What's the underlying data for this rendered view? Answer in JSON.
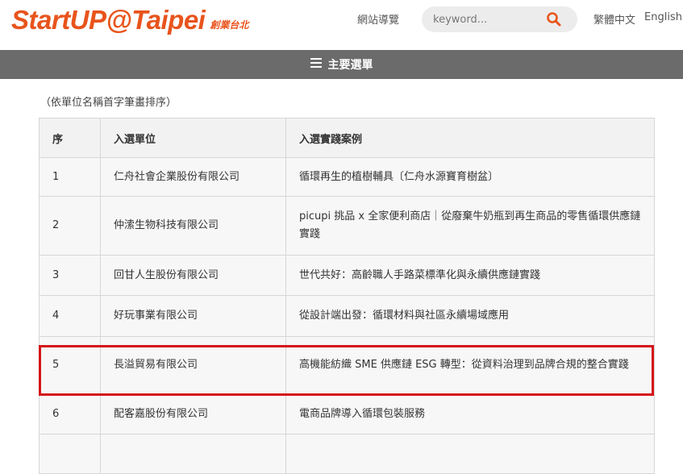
{
  "header": {
    "logo_main": "StartUP@Taipei",
    "logo_sub": "創業台北",
    "sitemap_label": "網站導覽",
    "search_placeholder": "keyword...",
    "search_icon": "search-icon",
    "lang_zh": "繁體中文",
    "lang_en": "English",
    "accent_color": "#e8541c"
  },
  "menu": {
    "label": "主要選單",
    "icon": "hamburger-icon",
    "bar_color": "#6b6b6b"
  },
  "note": "（依單位名稱首字筆畫排序）",
  "table": {
    "headers": [
      "序",
      "入選單位",
      "入選實踐案例"
    ],
    "rows": [
      {
        "seq": "1",
        "unit": "仁舟社會企業股份有限公司",
        "case": "循環再生的植樹輔具〔仁舟水源寶育樹盆〕"
      },
      {
        "seq": "2",
        "unit": "仲溹生物科技有限公司",
        "case": "picupi 挑品 x 全家便利商店｜從廢棄牛奶瓶到再生商品的零售循環供應鏈實踐"
      },
      {
        "seq": "3",
        "unit": "回甘人生股份有限公司",
        "case": "世代共好：高齡職人手路菜標準化與永續供應鏈實踐"
      },
      {
        "seq": "4",
        "unit": "好玩事業有限公司",
        "case": "從設計端出發：循環材料與社區永續場域應用"
      },
      {
        "seq": "5",
        "unit": "長溢貿易有限公司",
        "case": "高機能紡織 SME 供應鏈 ESG 轉型：從資料治理到品牌合規的整合實踐"
      },
      {
        "seq": "6",
        "unit": "配客嘉股份有限公司",
        "case": "電商品牌導入循環包裝服務"
      },
      {
        "seq": "",
        "unit": "",
        "case": ""
      }
    ]
  },
  "highlight_color": "#d51418"
}
